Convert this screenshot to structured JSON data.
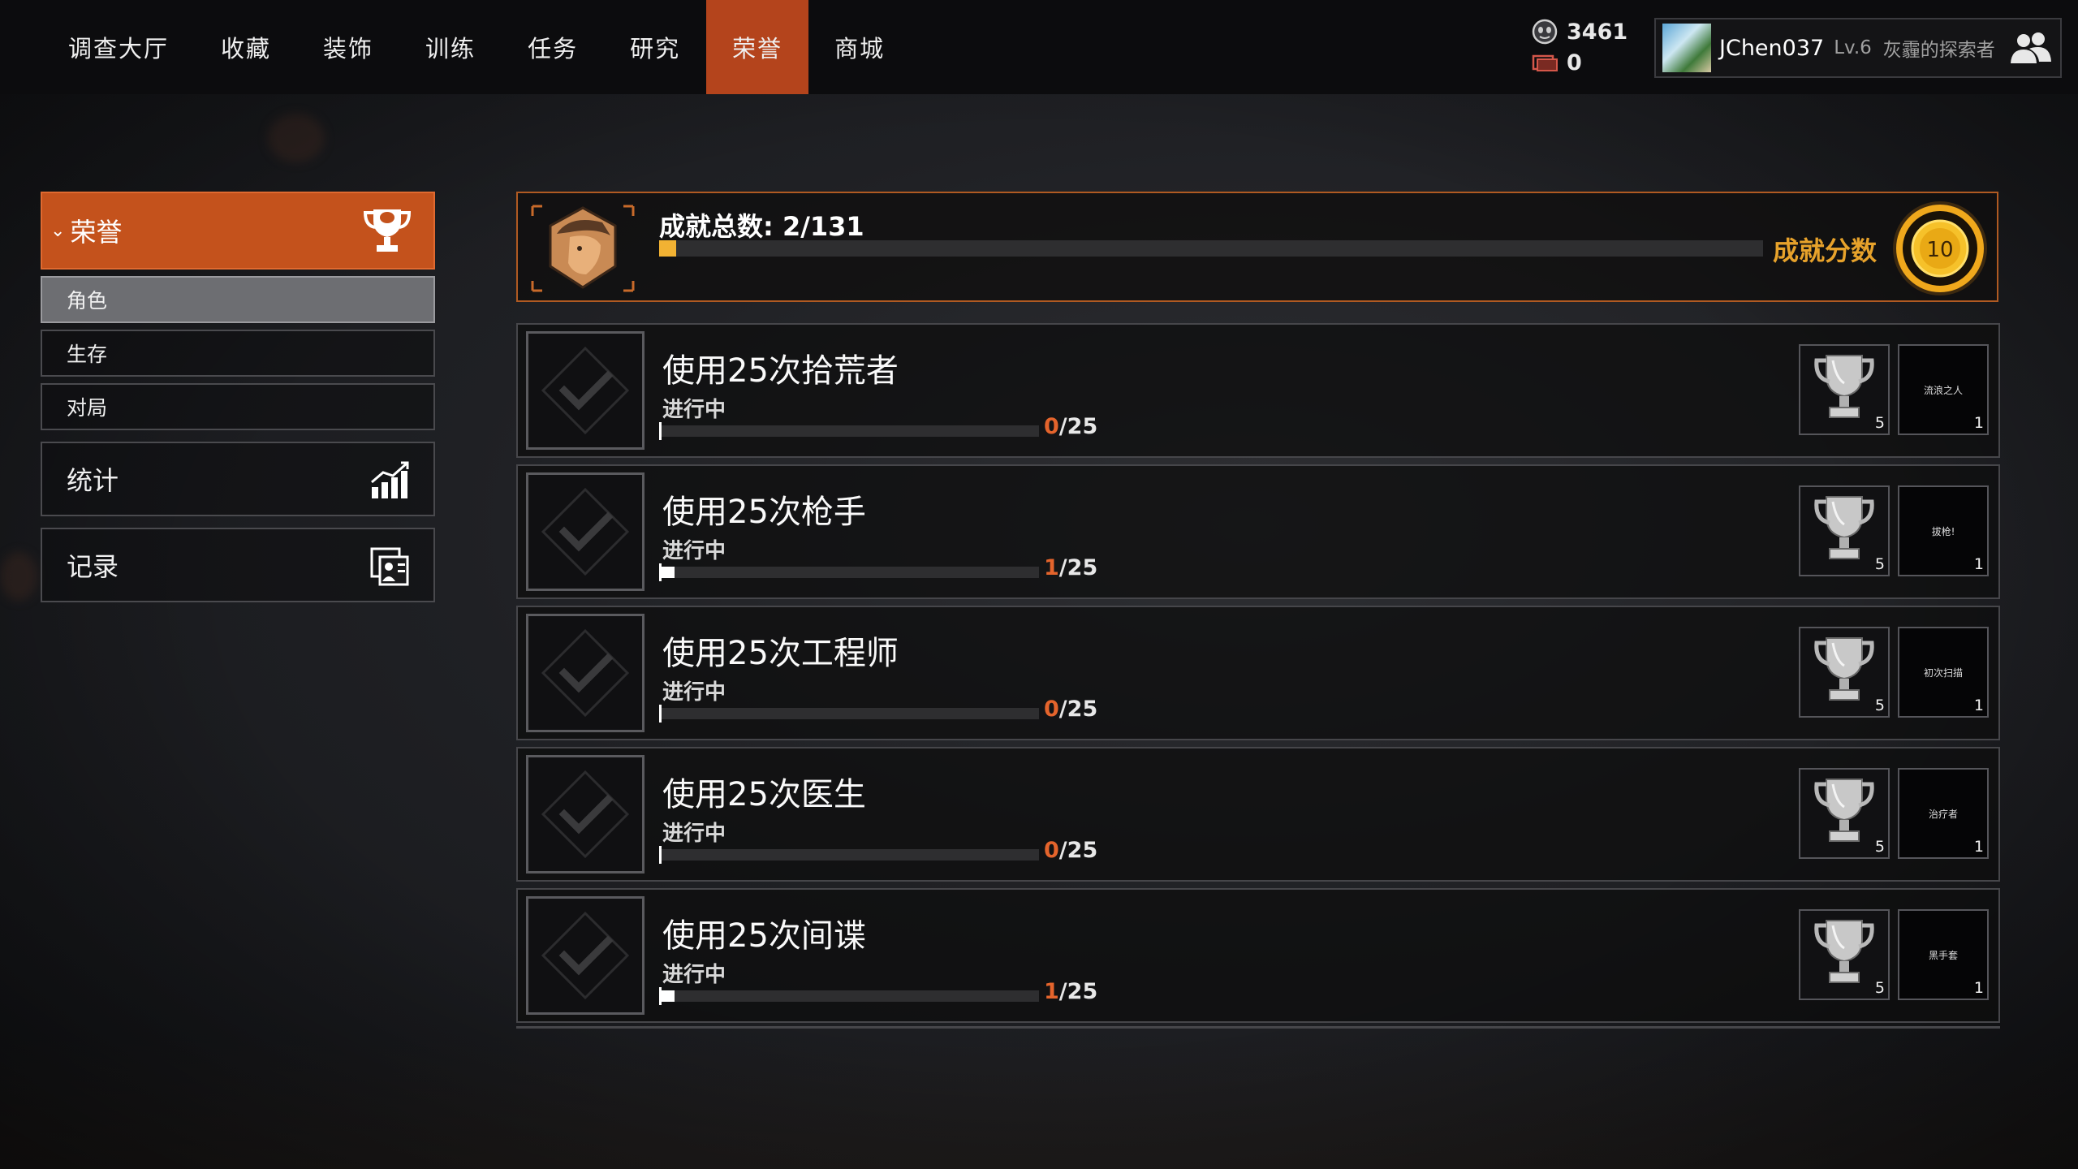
{
  "nav": {
    "items": [
      {
        "label": "调查大厅",
        "active": false
      },
      {
        "label": "收藏",
        "active": false
      },
      {
        "label": "装饰",
        "active": false
      },
      {
        "label": "训练",
        "active": false
      },
      {
        "label": "任务",
        "active": false
      },
      {
        "label": "研究",
        "active": false
      },
      {
        "label": "荣誉",
        "active": true
      },
      {
        "label": "商城",
        "active": false
      }
    ],
    "active_color": "#b4441c"
  },
  "currency": {
    "primary": {
      "icon": "mask-coin-icon",
      "value": "3461"
    },
    "secondary": {
      "icon": "ticket-icon",
      "value": "0"
    }
  },
  "profile": {
    "name": "JChen037",
    "level": "Lv.6",
    "title": "灰霾的探索者",
    "friends_icon": "friends-icon"
  },
  "sidebar": {
    "header": {
      "label": "荣誉",
      "icon": "trophy-icon"
    },
    "sub_items": [
      {
        "label": "角色",
        "active": true
      },
      {
        "label": "生存",
        "active": false
      },
      {
        "label": "对局",
        "active": false
      }
    ],
    "big_items": [
      {
        "label": "统计",
        "icon": "stats-chart-icon"
      },
      {
        "label": "记录",
        "icon": "records-icon"
      }
    ]
  },
  "summary": {
    "title": "成就总数: 2/131",
    "completed": 2,
    "total": 131,
    "score_label": "成就分数",
    "score": "10",
    "accent": "#e7a22b"
  },
  "achievements": [
    {
      "title": "使用25次拾荒者",
      "status": "进行中",
      "current": "0",
      "total_label": "/25",
      "progress": 0,
      "trophy_points": "5",
      "reward_name": "流浪之人",
      "reward_count": "1"
    },
    {
      "title": "使用25次枪手",
      "status": "进行中",
      "current": "1",
      "total_label": "/25",
      "progress": 0.04,
      "trophy_points": "5",
      "reward_name": "拔枪!",
      "reward_count": "1"
    },
    {
      "title": "使用25次工程师",
      "status": "进行中",
      "current": "0",
      "total_label": "/25",
      "progress": 0,
      "trophy_points": "5",
      "reward_name": "初次扫描",
      "reward_count": "1"
    },
    {
      "title": "使用25次医生",
      "status": "进行中",
      "current": "0",
      "total_label": "/25",
      "progress": 0,
      "trophy_points": "5",
      "reward_name": "治疗者",
      "reward_count": "1"
    },
    {
      "title": "使用25次间谍",
      "status": "进行中",
      "current": "1",
      "total_label": "/25",
      "progress": 0.04,
      "trophy_points": "5",
      "reward_name": "黑手套",
      "reward_count": "1"
    }
  ]
}
